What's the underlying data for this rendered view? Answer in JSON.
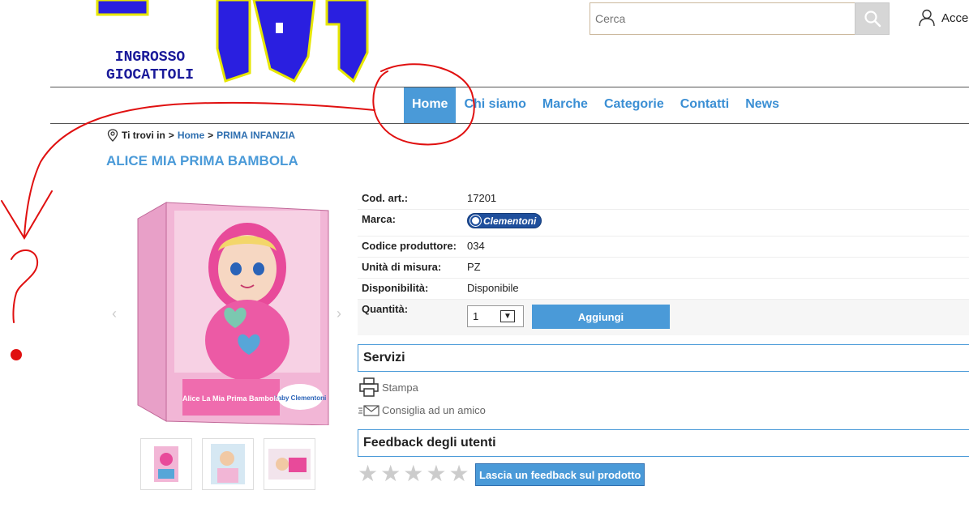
{
  "header": {
    "logo_subtitle_line1": "INGROSSO",
    "logo_subtitle_line2": "GIOCATTOLI",
    "search_placeholder": "Cerca",
    "account_label": "Accedi"
  },
  "nav": {
    "items": [
      "Home",
      "Chi siamo",
      "Marche",
      "Categorie",
      "Contatti",
      "News"
    ],
    "active": "Home"
  },
  "breadcrumb": {
    "prefix": "Ti trovi in",
    "sep": ">",
    "home": "Home",
    "current": "PRIMA INFANZIA"
  },
  "product": {
    "title": "ALICE MIA PRIMA BAMBOLA",
    "box_text_top": "baby Clementoni",
    "box_text_main": "Alice La Mia Prima Bambola",
    "specs": {
      "code_label": "Cod. art.:",
      "code_value": "17201",
      "brand_label": "Marca:",
      "brand_value": "Clementoni",
      "producer_code_label": "Codice produttore:",
      "producer_code_value": "034",
      "unit_label": "Unità di misura:",
      "unit_value": "PZ",
      "availability_label": "Disponibilità:",
      "availability_value": "Disponibile",
      "quantity_label": "Quantità:",
      "quantity_value": "1"
    },
    "add_button": "Aggiungi"
  },
  "services": {
    "heading": "Servizi",
    "print_label": "Stampa",
    "recommend_label": "Consiglia ad un amico"
  },
  "feedback": {
    "heading": "Feedback degli utenti",
    "rating": 0,
    "max_rating": 5,
    "button_label": "Lascia un feedback sul prodotto"
  },
  "colors": {
    "accent": "#4a9ad8",
    "link": "#2e6fb0",
    "available": "#1aa01a",
    "annotation": "#e01010"
  }
}
